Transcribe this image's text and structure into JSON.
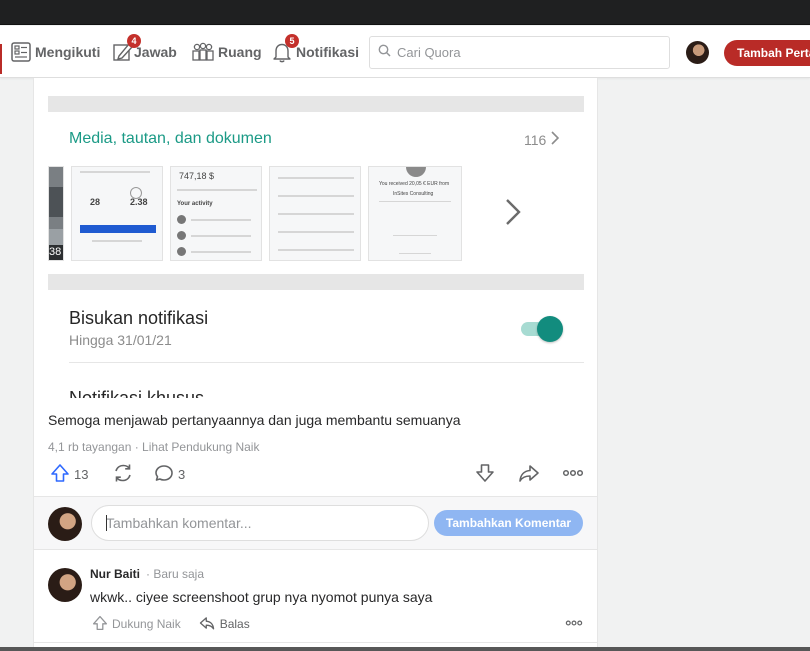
{
  "header": {
    "nav": {
      "following": "Mengikuti",
      "answer": "Jawab",
      "answer_badge": "4",
      "spaces": "Ruang",
      "notifications": "Notifikasi",
      "notifications_badge": "5"
    },
    "search_placeholder": "Cari Quora",
    "add_question": "Tambah Pertanyaan"
  },
  "embedded_screenshot": {
    "media_title": "Media, tautan, dan dokumen",
    "media_count": "116",
    "thumb_texts": {
      "left_num": "38",
      "stat_a": "28",
      "stat_b": "2.38",
      "amount": "747,18 $",
      "activity": "Your activity",
      "received": "You received 20,05 € EUR from",
      "company": "InSites Consulting"
    },
    "mute_title": "Bisukan notifikasi",
    "mute_sub": "Hingga 31/01/21",
    "toggle_on": true,
    "cut_text": "Notifikasi khusus"
  },
  "answer": {
    "text": "Semoga menjawab pertanyaannya dan juga membantu semuanya",
    "meta": "4,1 rb tayangan · Lihat Pendukung Naik",
    "upvotes": "13",
    "comments": "3"
  },
  "comment_box": {
    "placeholder": "Tambahkan komentar...",
    "button": "Tambahkan Komentar"
  },
  "comment": {
    "author": "Nur Baiti",
    "time": "· Baru saja",
    "text": "wkwk.. ciyee screenshoot grup nya nyomot punya saya",
    "upvote_label": "Dukung Naik",
    "reply_label": "Balas"
  },
  "colors": {
    "brand": "#b92b27",
    "whatsapp_teal": "#128c7e",
    "upvote_blue": "#2e69ff",
    "button_disabled_blue": "#8fb6f2"
  }
}
